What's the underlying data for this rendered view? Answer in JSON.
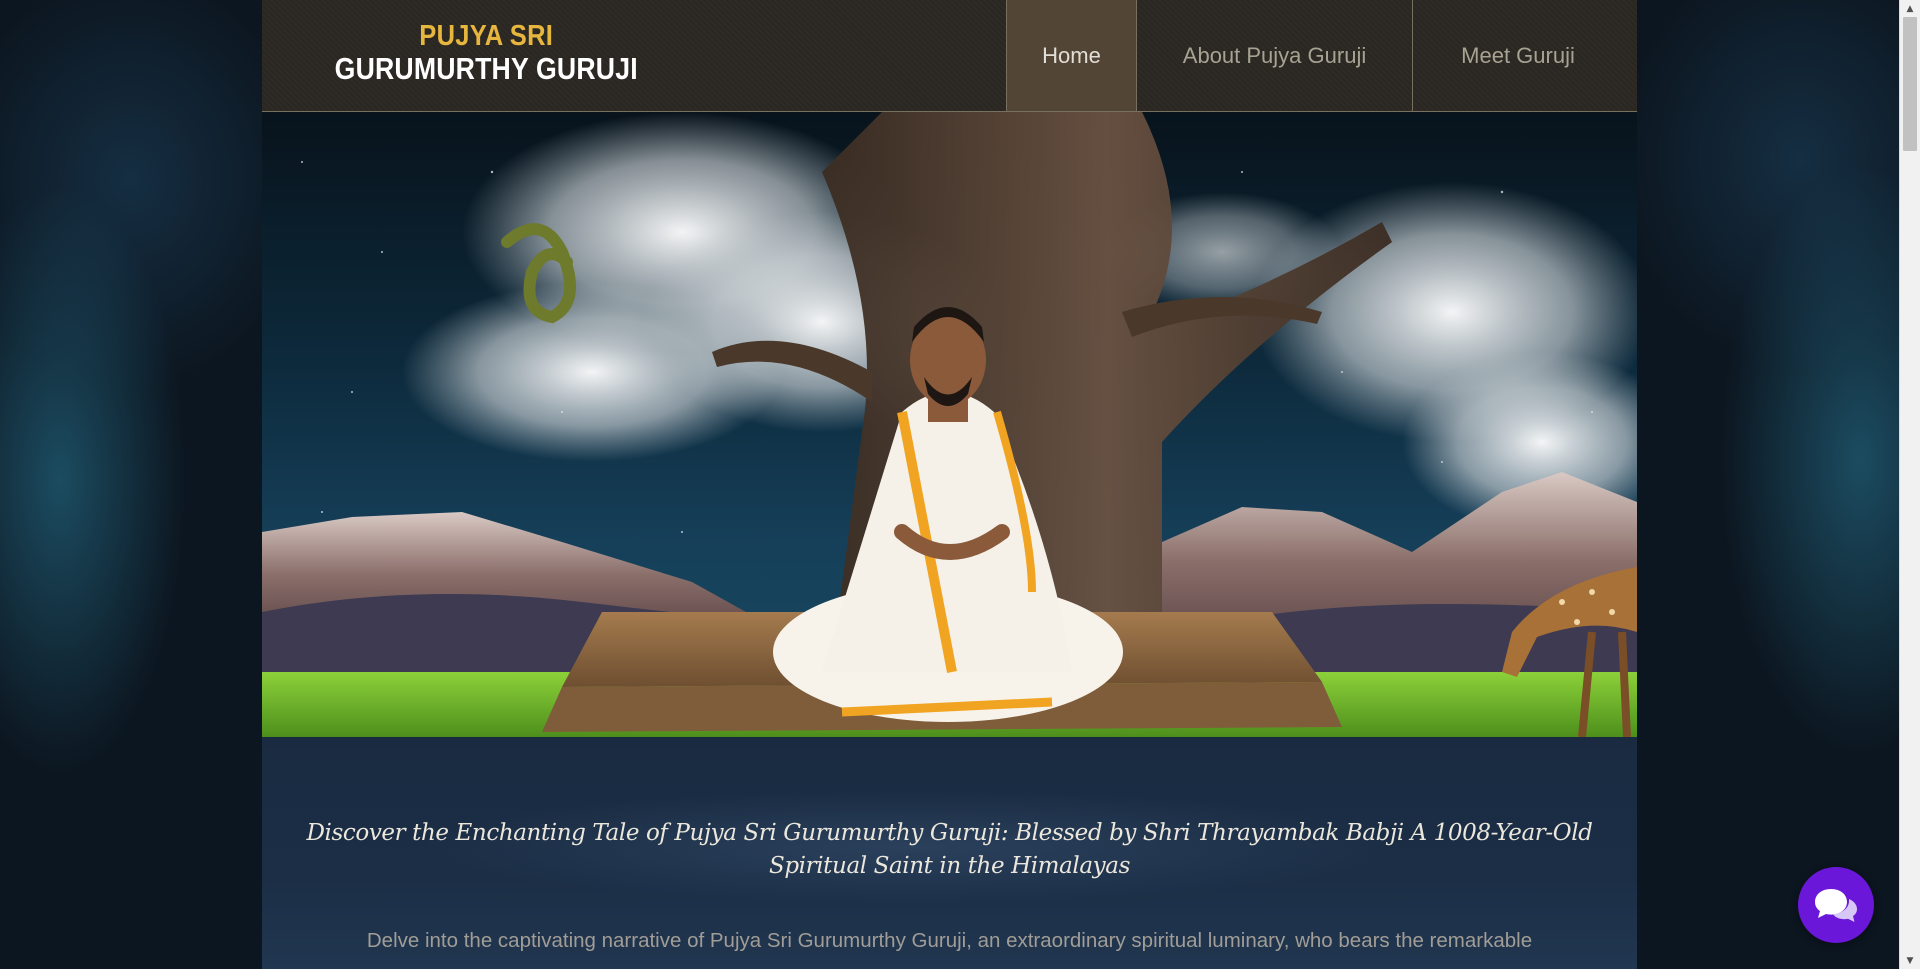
{
  "logo": {
    "line1": "PUJYA SRI",
    "line2": "GURUMURTHY GURUJI"
  },
  "nav": {
    "items": [
      {
        "label": "Home",
        "active": true
      },
      {
        "label": "About Pujya Guruji",
        "active": false
      },
      {
        "label": "Meet Guruji",
        "active": false
      }
    ]
  },
  "content": {
    "headline": "Discover the Enchanting Tale of Pujya Sri Gurumurthy Guruji: Blessed by Shri Thrayambak Babji A 1008-Year-Old Spiritual Saint in the Himalayas",
    "intro": "Delve into the captivating narrative of Pujya Sri Gurumurthy Guruji, an extraordinary spiritual luminary, who bears the remarkable"
  },
  "colors": {
    "logo_gold": "#e7b63e",
    "nav_active_bg": "#524536",
    "chat_purple": "#6a17d9"
  },
  "icons": {
    "chat": "chat-bubbles-icon"
  }
}
